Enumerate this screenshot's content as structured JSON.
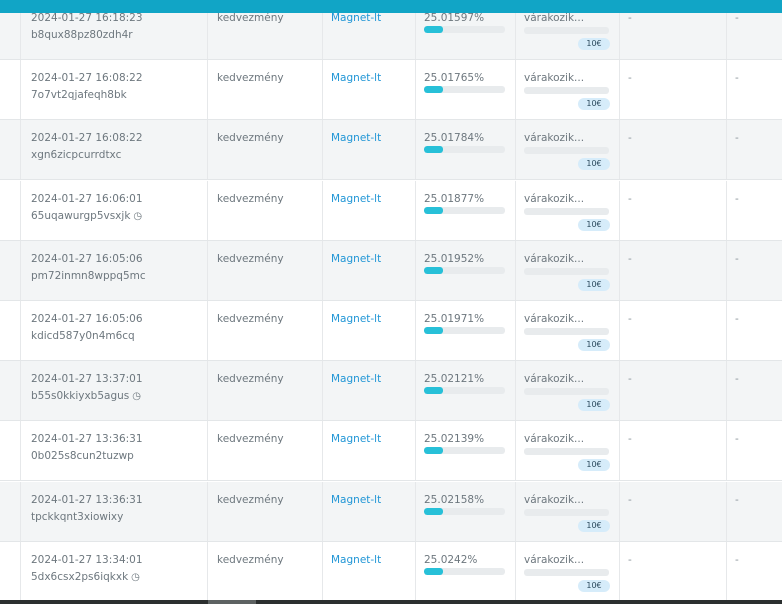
{
  "colors": {
    "accent": "#11a5c6",
    "link": "#2196d6",
    "progress": "#27c0d8",
    "badge": "#d6ecfa"
  },
  "rows": [
    {
      "timestamp": "2024-01-27 16:18:23",
      "hash": "b8qux88pz80zdh4r",
      "clock": false,
      "type": "kedvezmény",
      "client": "Magnet-lt",
      "percent": "25.01597%",
      "progress": 0.24,
      "status": "várakozik...",
      "fee": "10€",
      "col_a": "-",
      "col_b": "-"
    },
    {
      "timestamp": "2024-01-27 16:08:22",
      "hash": "7o7vt2qjafeqh8bk",
      "clock": false,
      "type": "kedvezmény",
      "client": "Magnet-lt",
      "percent": "25.01765%",
      "progress": 0.24,
      "status": "várakozik...",
      "fee": "10€",
      "col_a": "-",
      "col_b": "-"
    },
    {
      "timestamp": "2024-01-27 16:08:22",
      "hash": "xgn6zicpcurrdtxc",
      "clock": false,
      "type": "kedvezmény",
      "client": "Magnet-lt",
      "percent": "25.01784%",
      "progress": 0.24,
      "status": "várakozik...",
      "fee": "10€",
      "col_a": "-",
      "col_b": "-"
    },
    {
      "timestamp": "2024-01-27 16:06:01",
      "hash": "65uqawurgp5vsxjk",
      "clock": true,
      "type": "kedvezmény",
      "client": "Magnet-lt",
      "percent": "25.01877%",
      "progress": 0.24,
      "status": "várakozik...",
      "fee": "10€",
      "col_a": "-",
      "col_b": "-"
    },
    {
      "timestamp": "2024-01-27 16:05:06",
      "hash": "pm72inmn8wppq5mc",
      "clock": false,
      "type": "kedvezmény",
      "client": "Magnet-lt",
      "percent": "25.01952%",
      "progress": 0.24,
      "status": "várakozik...",
      "fee": "10€",
      "col_a": "-",
      "col_b": "-"
    },
    {
      "timestamp": "2024-01-27 16:05:06",
      "hash": "kdicd587y0n4m6cq",
      "clock": false,
      "type": "kedvezmény",
      "client": "Magnet-lt",
      "percent": "25.01971%",
      "progress": 0.24,
      "status": "várakozik...",
      "fee": "10€",
      "col_a": "-",
      "col_b": "-"
    },
    {
      "timestamp": "2024-01-27 13:37:01",
      "hash": "b55s0kkiyxb5agus",
      "clock": true,
      "type": "kedvezmény",
      "client": "Magnet-lt",
      "percent": "25.02121%",
      "progress": 0.24,
      "status": "várakozik...",
      "fee": "10€",
      "col_a": "-",
      "col_b": "-"
    },
    {
      "timestamp": "2024-01-27 13:36:31",
      "hash": "0b025s8cun2tuzwp",
      "clock": false,
      "type": "kedvezmény",
      "client": "Magnet-lt",
      "percent": "25.02139%",
      "progress": 0.24,
      "status": "várakozik...",
      "fee": "10€",
      "col_a": "-",
      "col_b": "-"
    },
    {
      "timestamp": "2024-01-27 13:36:31",
      "hash": "tpckkqnt3xiowixy",
      "clock": false,
      "type": "kedvezmény",
      "client": "Magnet-lt",
      "percent": "25.02158%",
      "progress": 0.24,
      "status": "várakozik...",
      "fee": "10€",
      "col_a": "-",
      "col_b": "-"
    },
    {
      "timestamp": "2024-01-27 13:34:01",
      "hash": "5dx6csx2ps6iqkxk",
      "clock": true,
      "type": "kedvezmény",
      "client": "Magnet-lt",
      "percent": "25.0242%",
      "progress": 0.24,
      "status": "várakozik...",
      "fee": "10€",
      "col_a": "-",
      "col_b": "-"
    }
  ]
}
